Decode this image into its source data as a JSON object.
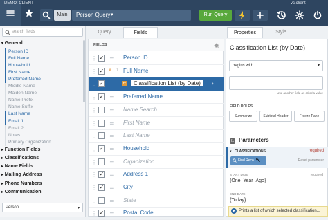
{
  "topbar": {
    "demo_label": "DEMO: CLIENT",
    "client": "vc.client",
    "main_tab": "Main",
    "query_name": "Person Query",
    "query_caret": "▾",
    "run_query": "Run Query"
  },
  "sidebar": {
    "search_placeholder": "search fields",
    "groups": [
      {
        "label": "General",
        "expanded": true
      },
      {
        "label": "Function Fields"
      },
      {
        "label": "Classifications"
      },
      {
        "label": "Name Fields"
      },
      {
        "label": "Mailing Address"
      },
      {
        "label": "Phone Numbers"
      },
      {
        "label": "Communication"
      }
    ],
    "general_items": [
      {
        "label": "Person ID",
        "active": true
      },
      {
        "label": "Full Name",
        "active": true
      },
      {
        "label": "Household",
        "active": true
      },
      {
        "label": "First Name",
        "active": true
      },
      {
        "label": "Preferred Name",
        "active": true
      },
      {
        "label": "Middle Name",
        "active": false
      },
      {
        "label": "Maiden Name",
        "active": false
      },
      {
        "label": "Name Prefix",
        "active": false
      },
      {
        "label": "Name Suffix",
        "active": false
      },
      {
        "label": "Last Name",
        "active": true
      },
      {
        "label": "Email 1",
        "active": true
      },
      {
        "label": "Email 2",
        "active": false
      },
      {
        "label": "Notes",
        "active": false
      },
      {
        "label": "Primary Organization",
        "active": false
      }
    ],
    "entity_select": "Person"
  },
  "tabs": {
    "query": "Query",
    "fields": "Fields",
    "properties": "Properties",
    "style": "Style"
  },
  "fields_panel": {
    "header": "FIELDS",
    "rows": [
      {
        "label": "Person ID",
        "checked": true,
        "active": true
      },
      {
        "label": "Full Name",
        "checked": true,
        "active": true,
        "sort": "1"
      },
      {
        "label": "Classification List (by Date)",
        "checked": true,
        "active": true,
        "badge": "fx",
        "selected": true
      },
      {
        "label": "Preferred Name",
        "checked": true,
        "active": true
      },
      {
        "label": "Name Search",
        "checked": false,
        "active": false
      },
      {
        "label": "First Name",
        "checked": false,
        "active": false
      },
      {
        "label": "Last Name",
        "checked": false,
        "active": false
      },
      {
        "label": "Household",
        "checked": true,
        "active": true
      },
      {
        "label": "Organization",
        "checked": false,
        "active": false
      },
      {
        "label": "Address 1",
        "checked": true,
        "active": true
      },
      {
        "label": "City",
        "checked": true,
        "active": true
      },
      {
        "label": "State",
        "checked": false,
        "active": false
      },
      {
        "label": "Postal Code",
        "checked": true,
        "active": true
      }
    ]
  },
  "properties": {
    "field_title": "Classification List (by Date)",
    "operator": "begins with",
    "criteria_hint": "Use another field as criteria value",
    "field_roles_label": "FIELD ROLES",
    "roles": [
      "Summarize",
      "Subtotal Header",
      "Freeze Pane"
    ],
    "parameters_label": "Parameters",
    "fx_badge": "fx",
    "classifications_label": "CLASSIFICATIONS",
    "required": "required",
    "find_button": "Find Reco...",
    "reset": "Reset parameter",
    "start_date_label": "START DATE",
    "start_date_value": "{One_Year_Ago}",
    "end_date_label": "END DATE",
    "end_date_value": "{Today}",
    "tooltip": "Prints a list of which selected classification..."
  }
}
